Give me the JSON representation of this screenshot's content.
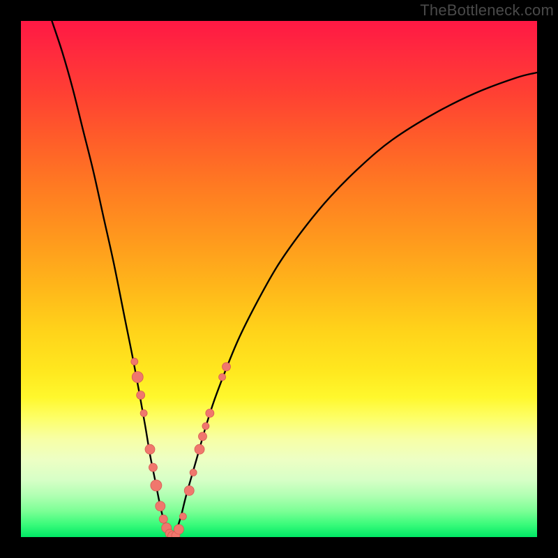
{
  "watermark": "TheBottleneck.com",
  "colors": {
    "curve": "#000000",
    "marker_fill": "#f0776d",
    "marker_stroke": "#d55b52",
    "gradient_top": "#ff1844",
    "gradient_bottom": "#00e865"
  },
  "chart_data": {
    "type": "line",
    "title": "",
    "xlabel": "",
    "ylabel": "",
    "xlim": [
      0,
      100
    ],
    "ylim": [
      0,
      100
    ],
    "series": [
      {
        "name": "bottleneck-curve",
        "x": [
          6,
          8,
          10,
          12,
          14,
          16,
          18,
          20,
          22,
          24,
          25,
          26,
          27,
          28,
          29,
          29.5,
          30,
          31,
          32,
          34,
          36,
          38,
          42,
          46,
          50,
          55,
          60,
          66,
          72,
          80,
          88,
          96,
          100
        ],
        "y": [
          100,
          94,
          87,
          79,
          71,
          62,
          53,
          43,
          33,
          22,
          16,
          11,
          6,
          2,
          0,
          0,
          1,
          4,
          8,
          15,
          22,
          28,
          38,
          46,
          53,
          60,
          66,
          72,
          77,
          82,
          86,
          89,
          90
        ]
      }
    ],
    "markers": [
      {
        "x": 22.0,
        "y": 34.0,
        "r": 5
      },
      {
        "x": 22.6,
        "y": 31.0,
        "r": 8
      },
      {
        "x": 23.2,
        "y": 27.5,
        "r": 6
      },
      {
        "x": 23.8,
        "y": 24.0,
        "r": 5
      },
      {
        "x": 25.0,
        "y": 17.0,
        "r": 7
      },
      {
        "x": 25.6,
        "y": 13.5,
        "r": 6
      },
      {
        "x": 26.2,
        "y": 10.0,
        "r": 8
      },
      {
        "x": 27.0,
        "y": 6.0,
        "r": 7
      },
      {
        "x": 27.6,
        "y": 3.5,
        "r": 6
      },
      {
        "x": 28.2,
        "y": 1.8,
        "r": 7
      },
      {
        "x": 28.8,
        "y": 0.7,
        "r": 6
      },
      {
        "x": 29.4,
        "y": 0.2,
        "r": 7
      },
      {
        "x": 30.0,
        "y": 0.3,
        "r": 6
      },
      {
        "x": 30.6,
        "y": 1.5,
        "r": 7
      },
      {
        "x": 31.4,
        "y": 4.0,
        "r": 5
      },
      {
        "x": 32.6,
        "y": 9.0,
        "r": 7
      },
      {
        "x": 33.4,
        "y": 12.5,
        "r": 5
      },
      {
        "x": 34.6,
        "y": 17.0,
        "r": 7
      },
      {
        "x": 35.2,
        "y": 19.5,
        "r": 6
      },
      {
        "x": 35.8,
        "y": 21.5,
        "r": 5
      },
      {
        "x": 36.6,
        "y": 24.0,
        "r": 6
      },
      {
        "x": 39.0,
        "y": 31.0,
        "r": 5
      },
      {
        "x": 39.8,
        "y": 33.0,
        "r": 6
      }
    ]
  }
}
